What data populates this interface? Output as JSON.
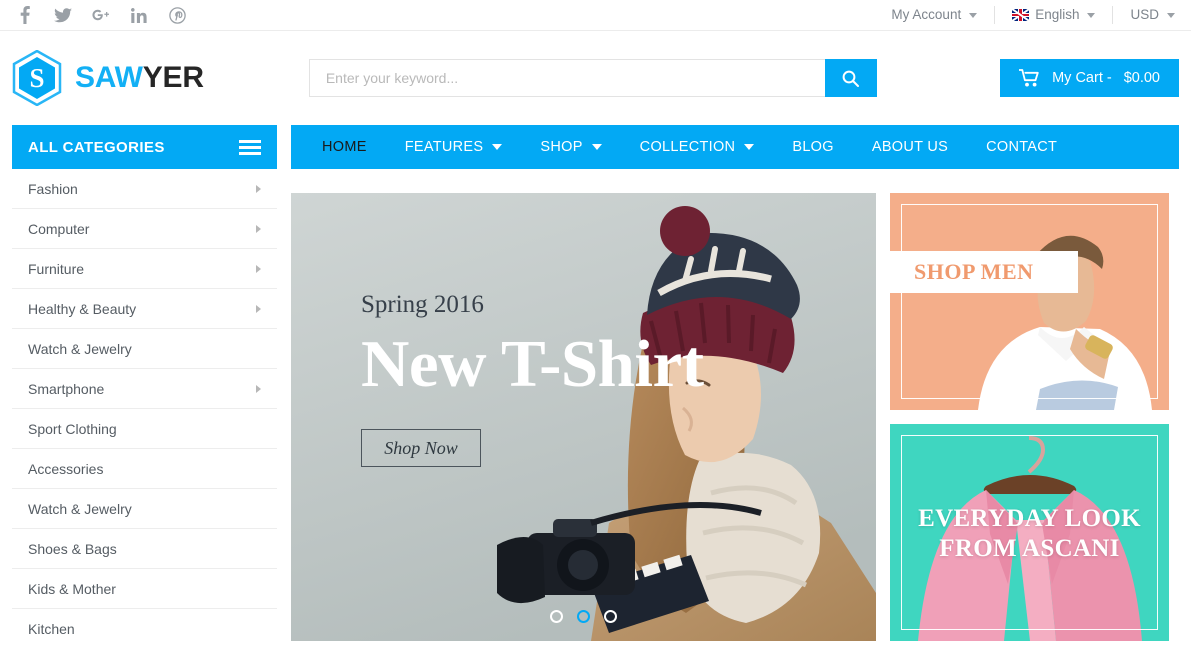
{
  "topbar": {
    "social": [
      {
        "name": "facebook-icon",
        "label": "f"
      },
      {
        "name": "twitter-icon",
        "label": "t"
      },
      {
        "name": "google-plus-icon",
        "label": "G+"
      },
      {
        "name": "linkedin-icon",
        "label": "in"
      },
      {
        "name": "pinterest-icon",
        "label": "P"
      }
    ],
    "account_label": "My Account",
    "language_label": "English",
    "currency_label": "USD"
  },
  "header": {
    "logo_part1": "SAW",
    "logo_part2": "YER",
    "logo_mark": "S",
    "search_placeholder": "Enter your keyword...",
    "search_value": "",
    "search_icon": "search-icon",
    "cart_label": "My Cart -",
    "cart_total": "$0.00",
    "cart_icon": "cart-icon"
  },
  "sidebar": {
    "title": "ALL CATEGORIES",
    "menu_icon": "hamburger-icon",
    "items": [
      {
        "label": "Fashion",
        "has_submenu": true
      },
      {
        "label": "Computer",
        "has_submenu": true
      },
      {
        "label": "Furniture",
        "has_submenu": true
      },
      {
        "label": "Healthy & Beauty",
        "has_submenu": true
      },
      {
        "label": "Watch & Jewelry",
        "has_submenu": false
      },
      {
        "label": "Smartphone",
        "has_submenu": true
      },
      {
        "label": "Sport Clothing",
        "has_submenu": false
      },
      {
        "label": "Accessories",
        "has_submenu": false
      },
      {
        "label": "Watch & Jewelry",
        "has_submenu": false
      },
      {
        "label": "Shoes & Bags",
        "has_submenu": false
      },
      {
        "label": "Kids & Mother",
        "has_submenu": false
      },
      {
        "label": "Kitchen",
        "has_submenu": false
      }
    ]
  },
  "nav": {
    "items": [
      {
        "label": "HOME",
        "active": true,
        "has_dropdown": false
      },
      {
        "label": "FEATURES",
        "active": false,
        "has_dropdown": true
      },
      {
        "label": "SHOP",
        "active": false,
        "has_dropdown": true
      },
      {
        "label": "COLLECTION",
        "active": false,
        "has_dropdown": true
      },
      {
        "label": "BLOG",
        "active": false,
        "has_dropdown": false
      },
      {
        "label": "ABOUT US",
        "active": false,
        "has_dropdown": false
      },
      {
        "label": "CONTACT",
        "active": false,
        "has_dropdown": false
      }
    ]
  },
  "hero": {
    "subtitle": "Spring 2016",
    "title": "New T-Shirt",
    "button_label": "Shop Now",
    "slides": 3,
    "active_slide": 2
  },
  "promos": [
    {
      "name": "shop-men",
      "label": "SHOP MEN",
      "bg": "#f4ae8a"
    },
    {
      "name": "everyday-look",
      "line1": "EVERYDAY LOOK",
      "line2": "FROM ASCANI",
      "bg": "#3fd6c0"
    }
  ],
  "colors": {
    "accent": "#03a9f4",
    "text": "#555c63",
    "peach": "#f4ae8a",
    "turquoise": "#3fd6c0"
  }
}
